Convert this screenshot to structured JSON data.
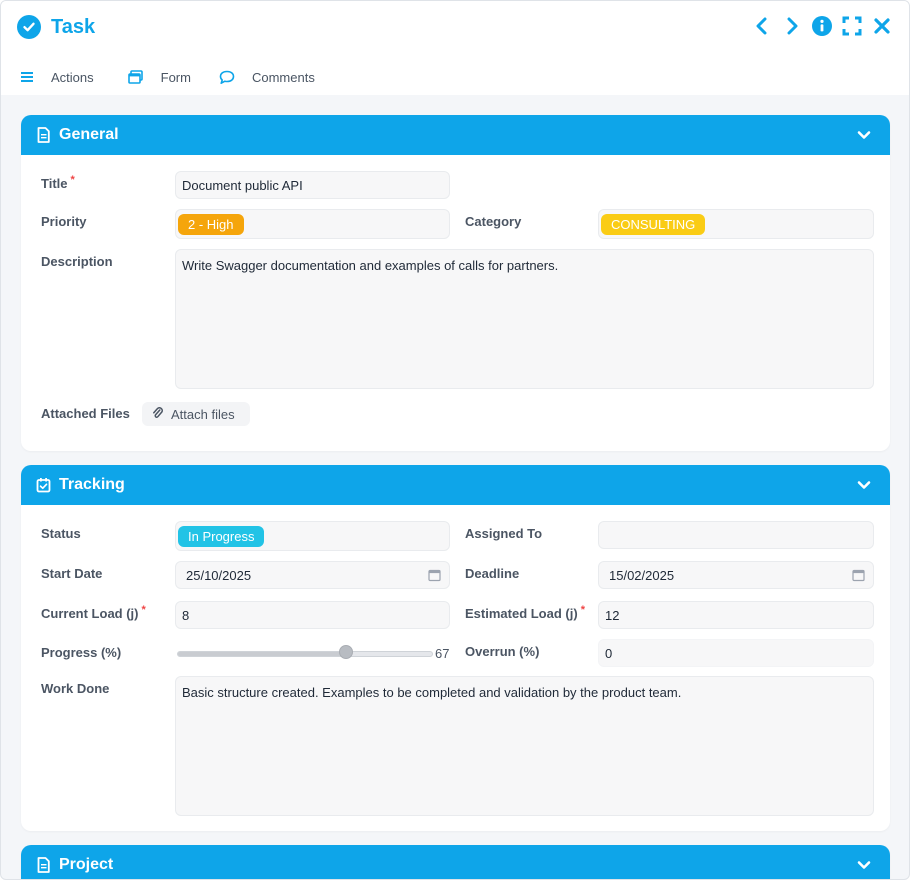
{
  "window": {
    "title": "Task"
  },
  "toolbar": {
    "actions_label": "Actions",
    "form_label": "Form",
    "comments_label": "Comments"
  },
  "colors": {
    "accent": "#0ea5e9",
    "priority_pill": "#f5a50b",
    "category_pill": "#facc15",
    "status_pill": "#22c3e6",
    "required": "#ef4444"
  },
  "general": {
    "header": "General",
    "title_label": "Title",
    "title_value": "Document public API",
    "priority_label": "Priority",
    "priority_value": "2 - High",
    "category_label": "Category",
    "category_value": "CONSULTING",
    "description_label": "Description",
    "description_value": "Write Swagger documentation and examples of calls for partners.",
    "attached_files_label": "Attached Files",
    "attach_button": "Attach files"
  },
  "tracking": {
    "header": "Tracking",
    "status_label": "Status",
    "status_value": "In Progress",
    "assigned_label": "Assigned To",
    "assigned_value": "",
    "start_date_label": "Start Date",
    "start_date_value": "25/10/2025",
    "deadline_label": "Deadline",
    "deadline_value": "15/02/2025",
    "current_load_label": "Current Load (j)",
    "current_load_value": "8",
    "estimated_load_label": "Estimated Load (j)",
    "estimated_load_value": "12",
    "progress_label": "Progress (%)",
    "progress_value": 67,
    "progress_text": "67",
    "overrun_label": "Overrun (%)",
    "overrun_value": "0",
    "work_done_label": "Work Done",
    "work_done_value": "Basic structure created. Examples to be completed and validation by the product team."
  },
  "project": {
    "header": "Project"
  },
  "required_mark": "*"
}
